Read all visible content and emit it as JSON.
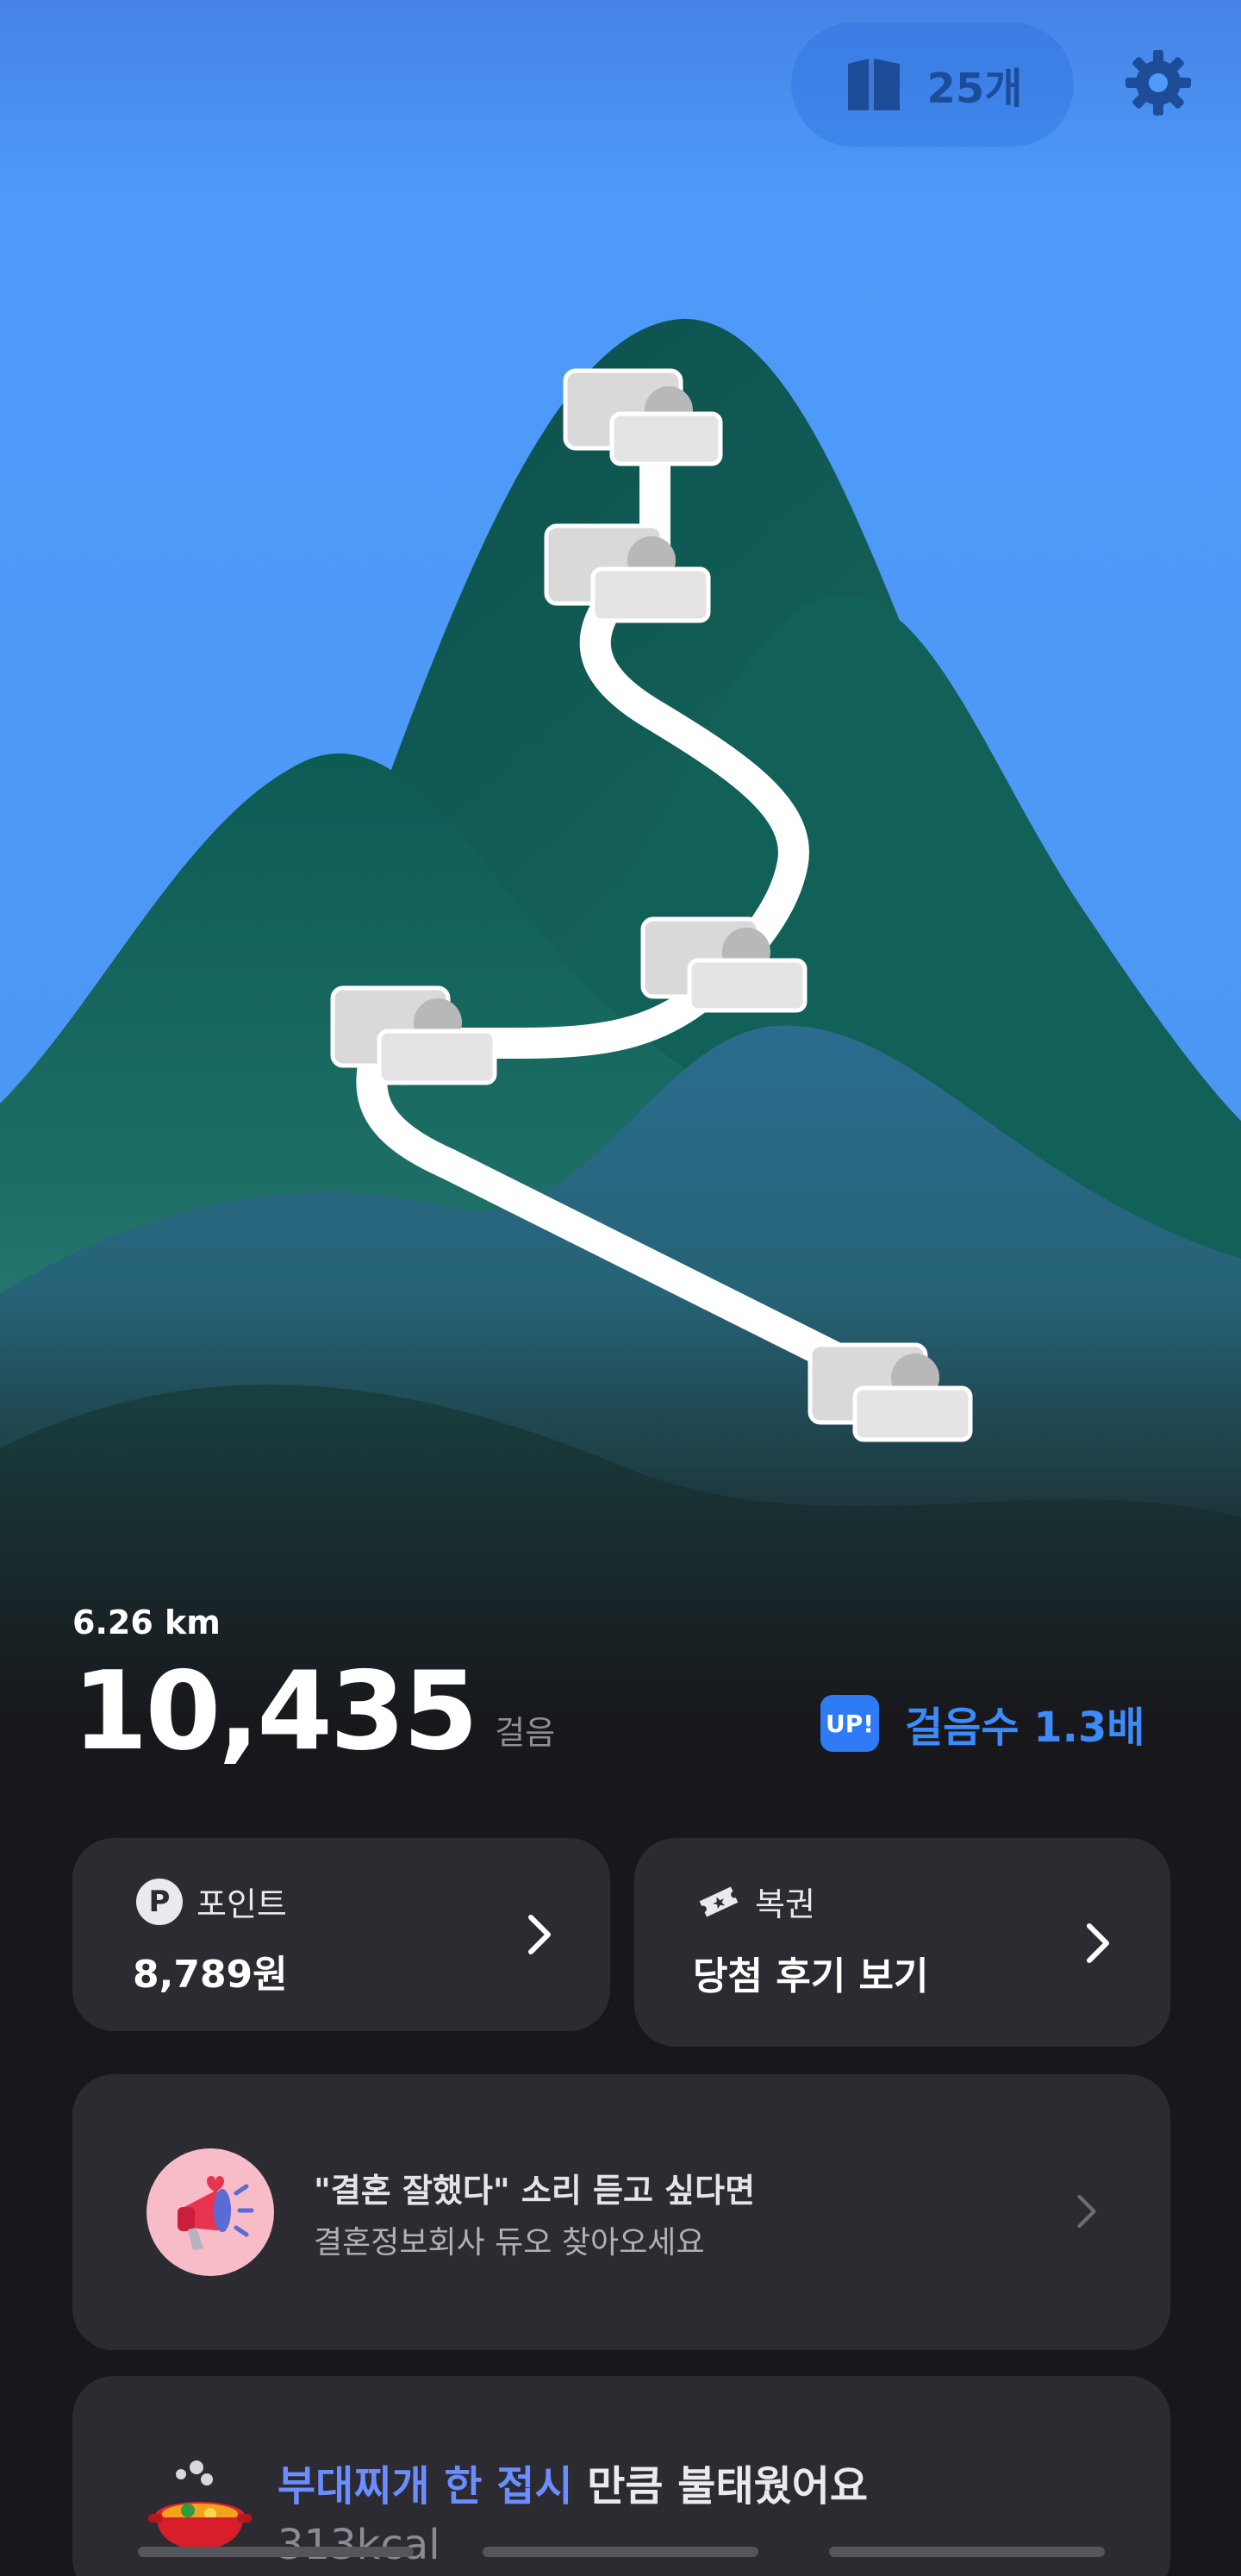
{
  "topbar": {
    "ticket_count": "25개",
    "ticket_icon": "ticket-book-icon",
    "settings_icon": "gear-icon"
  },
  "stats": {
    "distance": "6.26 km",
    "steps": "10,435",
    "steps_unit": "걸음",
    "boost_badge": "UP!",
    "boost_text": "걸음수 1.3배"
  },
  "cards": {
    "point": {
      "label": "포인트",
      "value": "8,789원",
      "icon": "point-coin-icon"
    },
    "lotto": {
      "label": "복권",
      "value": "당첨 후기 보기",
      "icon": "ticket-icon"
    },
    "ad": {
      "title": "\"결혼 잘했다\" 소리 듣고 싶다면",
      "subtitle": "결혼정보회사 듀오 찾아오세요",
      "icon": "megaphone-icon"
    },
    "food": {
      "highlight": "부대찌개 한 접시",
      "rest": " 만큼 불태웠어요",
      "kcal": "313kcal",
      "icon": "stew-pot-icon"
    }
  },
  "colors": {
    "sky": "#4d97f5",
    "mountain": "#155e57",
    "background": "#18181c",
    "card": "#2b2b31",
    "accent": "#3d8bf8"
  }
}
